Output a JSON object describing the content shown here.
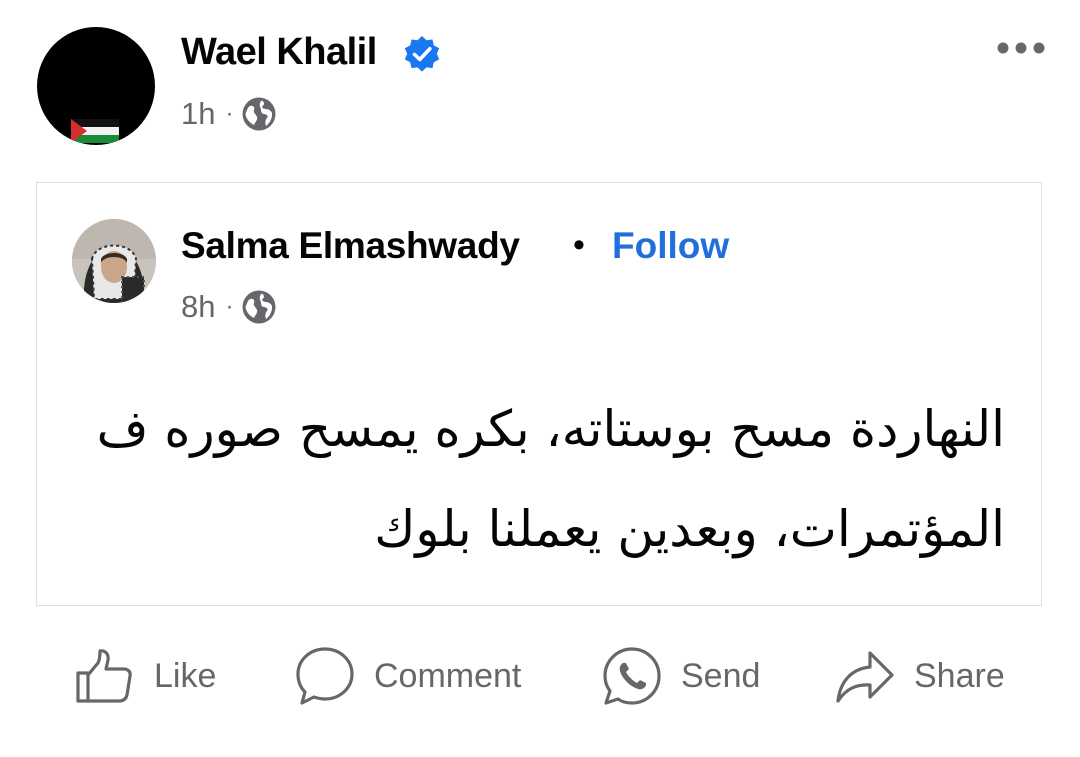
{
  "post": {
    "author": "Wael Khalil",
    "time": "1h",
    "separator": "·",
    "verified_icon": "verified-badge-icon",
    "audience_icon": "globe-icon",
    "more_icon": "more-options-icon"
  },
  "shared_post": {
    "author": "Salma Elmashwady",
    "separator": "•",
    "follow_label": "Follow",
    "time": "8h",
    "meta_separator": "·",
    "audience_icon": "globe-icon",
    "text": "النهاردة مسح بوستاته، بكره يمسح صوره ف المؤتمرات، وبعدين يعملنا بلوك"
  },
  "actions": {
    "like_label": "Like",
    "comment_label": "Comment",
    "send_label": "Send",
    "share_label": "Share"
  },
  "colors": {
    "link_blue": "#216fdb",
    "verified_blue": "#1877f2",
    "secondary_text": "#65676b",
    "primary_text": "#050505",
    "card_border": "#dddfe2"
  }
}
